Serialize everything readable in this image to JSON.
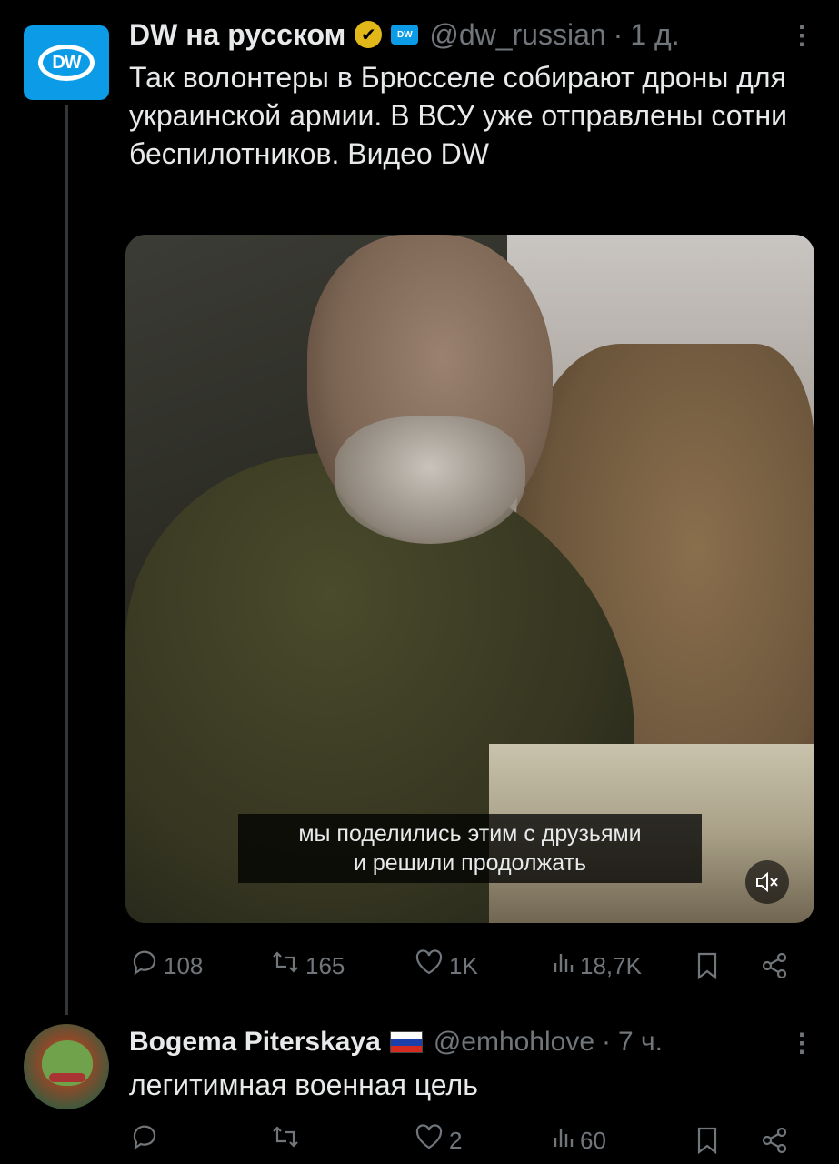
{
  "tweet": {
    "author_name": "DW на русском",
    "verified_badge_icon": "verified-gold-check-icon",
    "affiliate_label": "DW",
    "handle": "@dw_russian",
    "separator": "·",
    "time": "1 д.",
    "more_icon": "more-vertical-icon",
    "text": "Так волонтеры в Брюсселе собирают дроны для украинской армии. В ВСУ уже отправлены сотни беспилотников. Видео DW",
    "avatar_label": "DW",
    "media": {
      "subtitle_line1": "мы поделились этим с друзьями",
      "subtitle_line2": "и решили продолжать",
      "mute_icon": "volume-muted-icon"
    },
    "actions": {
      "replies": "108",
      "retweets": "165",
      "likes": "1K",
      "views": "18,7K",
      "icons": [
        "reply-icon",
        "retweet-icon",
        "like-icon",
        "views-icon",
        "bookmark-icon",
        "share-icon"
      ]
    }
  },
  "reply": {
    "author_name": "Bogema Piterskaya",
    "flag": "russia-flag",
    "handle": "@emhohlove",
    "separator": "·",
    "time": "7 ч.",
    "text": "легитимная военная цель",
    "actions": {
      "replies": "",
      "retweets": "",
      "likes": "2",
      "views": "60"
    }
  },
  "colors": {
    "background": "#000000",
    "text": "#e7e9ea",
    "muted": "#71767b",
    "dw_blue": "#0b9be7",
    "badge_gold": "#e2b719"
  }
}
